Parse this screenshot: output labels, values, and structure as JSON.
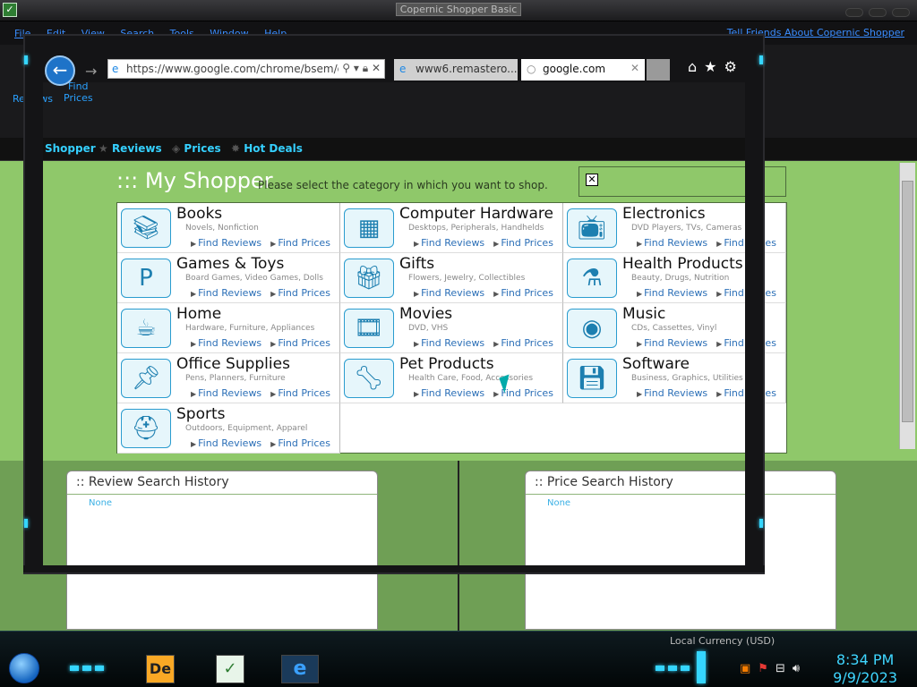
{
  "app": {
    "window_title": "Copernic Shopper Basic",
    "menu": [
      "File",
      "Edit",
      "View",
      "Search",
      "Tools",
      "Window",
      "Help"
    ],
    "top_links": "Tell Friends About Copernic Shopper",
    "toolbar": {
      "reviews_label": "Reviews",
      "find_prices_line1": "Find",
      "find_prices_line2": "Prices"
    },
    "nav": [
      "Shopper",
      "Reviews",
      "Prices",
      "Hot Deals"
    ]
  },
  "browser": {
    "url": "https://www.google.com/chrome/bsem/do",
    "tabs": [
      {
        "label": "www6.remastero...",
        "active": false
      },
      {
        "label": "google.com",
        "active": true
      }
    ]
  },
  "shopper": {
    "title": "::: My Shopper",
    "subtitle": "Please select the category in which you want to shop.",
    "find_reviews": "Find Reviews",
    "find_prices": "Find Prices",
    "categories": [
      {
        "name": "Books",
        "desc": "Novels, Nonfiction",
        "icon": "books-icon"
      },
      {
        "name": "Computer Hardware",
        "desc": "Desktops, Peripherals, Handhelds",
        "icon": "circuit-board-icon"
      },
      {
        "name": "Electronics",
        "desc": "DVD Players, TVs, Cameras",
        "icon": "television-icon"
      },
      {
        "name": "Games & Toys",
        "desc": "Board Games, Video Games, Dolls",
        "icon": "toy-block-icon"
      },
      {
        "name": "Gifts",
        "desc": "Flowers, Jewelry, Collectibles",
        "icon": "gift-box-icon"
      },
      {
        "name": "Health Products",
        "desc": "Beauty, Drugs, Nutrition",
        "icon": "medicine-bottle-icon"
      },
      {
        "name": "Home",
        "desc": "Hardware, Furniture, Appliances",
        "icon": "teacup-icon"
      },
      {
        "name": "Movies",
        "desc": "DVD, VHS",
        "icon": "film-reel-icon"
      },
      {
        "name": "Music",
        "desc": "CDs, Cassettes, Vinyl",
        "icon": "compact-disc-icon"
      },
      {
        "name": "Office Supplies",
        "desc": "Pens, Planners, Furniture",
        "icon": "pushpin-icon"
      },
      {
        "name": "Pet Products",
        "desc": "Health Care, Food, Accessories",
        "icon": "dog-bone-icon"
      },
      {
        "name": "Software",
        "desc": "Business, Graphics, Utilities",
        "icon": "floppy-disk-icon"
      },
      {
        "name": "Sports",
        "desc": "Outdoors, Equipment, Apparel",
        "icon": "football-helmet-icon"
      }
    ]
  },
  "history": {
    "review_title": ":: Review Search History",
    "price_title": ":: Price Search History",
    "none_text": "None"
  },
  "taskbar": {
    "currency": "Local Currency (USD)",
    "time": "8:34 PM",
    "date": "9/9/2023"
  },
  "colors": {
    "accent": "#35d6ff",
    "content_green": "#8fc86a",
    "link": "#2b6fb7"
  }
}
